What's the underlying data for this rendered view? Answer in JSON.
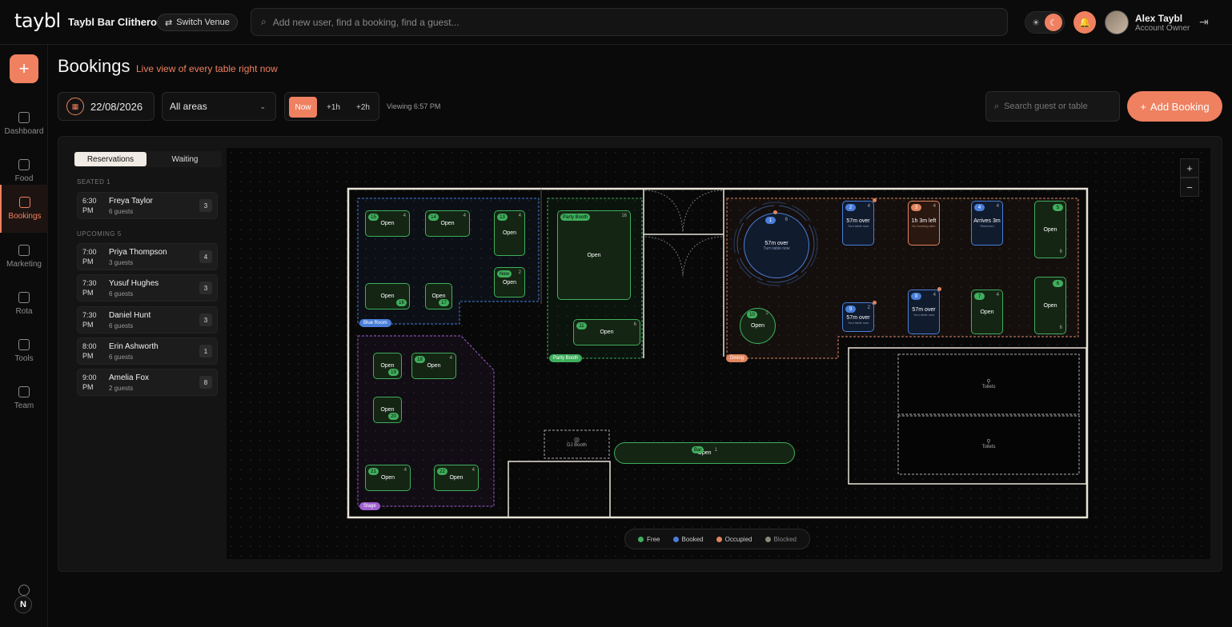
{
  "topbar": {
    "logo": "taybl",
    "venue": "Taybl Bar Clitheroe",
    "switch_venue": "Switch Venue",
    "search_placeholder": "Add new user, find a booking, find a guest...",
    "user_name": "Alex Taybl",
    "user_role": "Account Owner"
  },
  "sidebar": {
    "items": [
      {
        "label": "Dashboard"
      },
      {
        "label": "Food"
      },
      {
        "label": "Bookings"
      },
      {
        "label": "Marketing"
      },
      {
        "label": "Rota"
      },
      {
        "label": "Tools"
      },
      {
        "label": "Team"
      }
    ],
    "badge": "N"
  },
  "header": {
    "title": "Bookings",
    "subtitle": "Live view of every table right now",
    "date": "22/08/2026",
    "area": "All areas",
    "times": [
      "Now",
      "+1h",
      "+2h"
    ],
    "viewing": "Viewing 6:57 PM",
    "search_placeholder": "Search guest or table",
    "add_booking": "Add Booking"
  },
  "list": {
    "tabs": [
      "Reservations",
      "Waiting"
    ],
    "seated_label": "SEATED 1",
    "upcoming_label": "UPCOMING 5",
    "seated": [
      {
        "time": "6:30 PM",
        "name": "Freya Taylor",
        "guests": "6 guests",
        "count": "3"
      }
    ],
    "upcoming": [
      {
        "time": "7:00 PM",
        "name": "Priya Thompson",
        "guests": "3 guests",
        "count": "4"
      },
      {
        "time": "7:30 PM",
        "name": "Yusuf Hughes",
        "guests": "6 guests",
        "count": "3"
      },
      {
        "time": "7:30 PM",
        "name": "Daniel Hunt",
        "guests": "6 guests",
        "count": "3"
      },
      {
        "time": "8:00 PM",
        "name": "Erin Ashworth",
        "guests": "6 guests",
        "count": "1"
      },
      {
        "time": "9:00 PM",
        "name": "Amelia Fox",
        "guests": "2 guests",
        "count": "8"
      }
    ]
  },
  "floor": {
    "zones": {
      "blue": "Blue Room",
      "party": "Party Booth",
      "stage": "Stage",
      "dining": "Dining"
    },
    "tables": {
      "t15": {
        "num": "15",
        "seats": "4",
        "status": "Open"
      },
      "t14": {
        "num": "14",
        "seats": "4",
        "status": "Open"
      },
      "t13": {
        "num": "13",
        "seats": "4",
        "status": "Open"
      },
      "tnew": {
        "num": "New",
        "seats": "2",
        "status": "Open"
      },
      "t16": {
        "num": "16",
        "status": "Open"
      },
      "t17": {
        "num": "17",
        "status": "Open"
      },
      "tparty": {
        "num": "Party Booth",
        "seats": "16",
        "status": "Open"
      },
      "t11": {
        "num": "11",
        "seats": "6",
        "status": "Open"
      },
      "t19": {
        "num": "19",
        "status": "Open"
      },
      "t18": {
        "num": "18",
        "seats": "4",
        "status": "Open"
      },
      "t20": {
        "num": "20",
        "status": "Open"
      },
      "t21": {
        "num": "21",
        "seats": "4",
        "status": "Open"
      },
      "t22": {
        "num": "22",
        "seats": "4",
        "status": "Open"
      },
      "t1": {
        "num": "1",
        "seats": "6",
        "status": "57m over",
        "sub": "Turn table now"
      },
      "t10": {
        "num": "10",
        "seats": "2",
        "status": "Open"
      },
      "t2": {
        "num": "2",
        "seats": "4",
        "status": "57m over",
        "sub": "Turn table now"
      },
      "t3": {
        "num": "3",
        "seats": "4",
        "status": "1h 3m left",
        "sub": "No booking after"
      },
      "t4": {
        "num": "4",
        "seats": "4",
        "status": "Arrives 3m",
        "sub": "Reserved"
      },
      "t5": {
        "num": "5",
        "seats": "6",
        "status": "Open"
      },
      "t9": {
        "num": "9",
        "seats": "2",
        "status": "57m over",
        "sub": "Turn table now"
      },
      "t8": {
        "num": "8",
        "seats": "4",
        "status": "57m over",
        "sub": "Turn table now"
      },
      "t7": {
        "num": "7",
        "seats": "4",
        "status": "Open"
      },
      "t6": {
        "num": "6",
        "seats": "6",
        "status": "Open"
      },
      "tbar": {
        "num": "Bar",
        "seats": "1",
        "status": "Open"
      }
    },
    "dj_booth": "DJ Booth",
    "toilets": "Toilets"
  },
  "legend": {
    "free": "Free",
    "booked": "Booked",
    "occupied": "Occupied",
    "blocked": "Blocked"
  },
  "colors": {
    "accent": "#ef8060",
    "free": "#3fae5c",
    "booked": "#4a7ed8",
    "occupied": "#e0855e",
    "blocked": "#8a8a7a"
  }
}
